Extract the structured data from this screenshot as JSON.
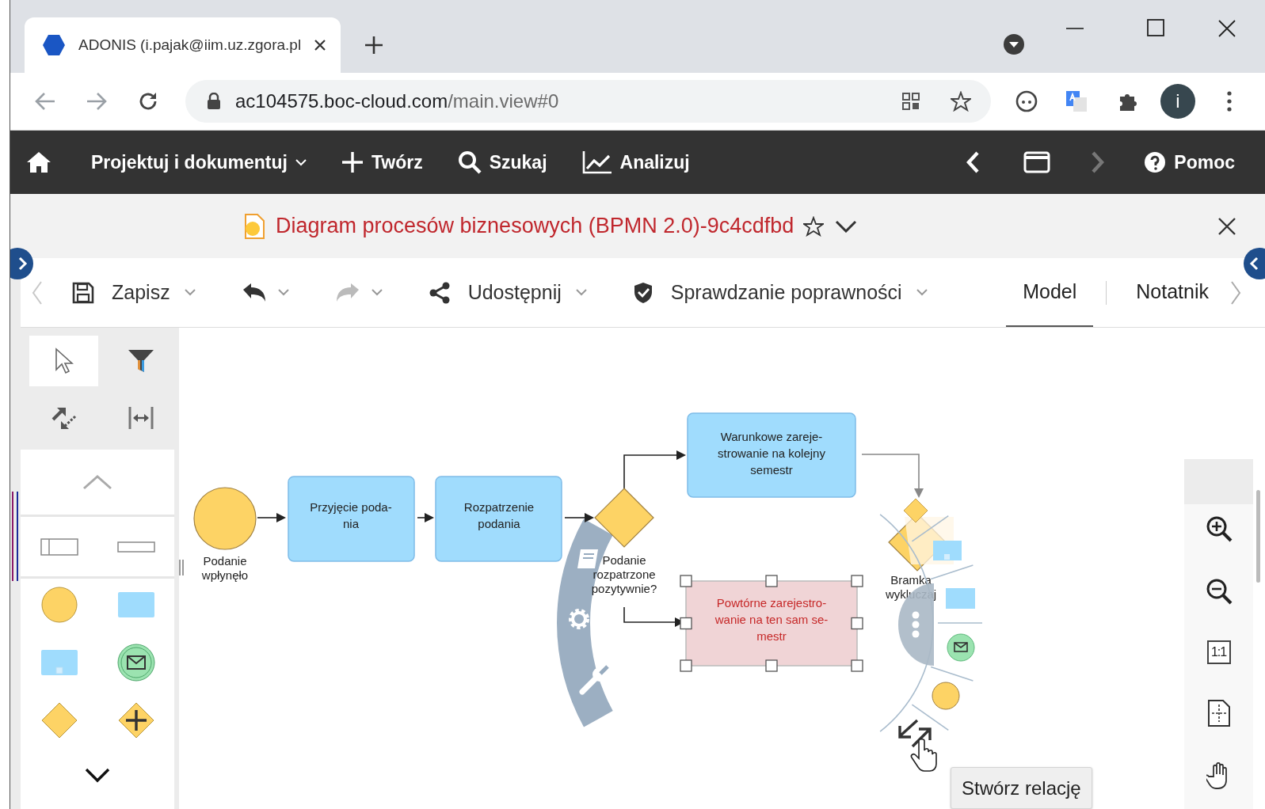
{
  "browser": {
    "tab": {
      "title": "ADONIS (i.pajak@iim.uz.zgora.pl",
      "selected": true
    },
    "url_host": "ac104575.boc-cloud.com",
    "url_path": "/main.view#0",
    "avatar_letter": "i"
  },
  "nav": {
    "items": [
      {
        "label": "Projektuj i dokumentuj",
        "kind": "menu"
      },
      {
        "label": "Twórz",
        "kind": "create"
      },
      {
        "label": "Szukaj",
        "kind": "search"
      },
      {
        "label": "Analizuj",
        "kind": "analyze"
      }
    ],
    "back_disabled": false,
    "forward_disabled": true,
    "help": "Pomoc"
  },
  "model_title": {
    "text": "Diagram procesów biznesowych (BPMN 2.0)-9c4cdfbd",
    "favorite": false
  },
  "toolbar": {
    "actions": [
      {
        "label": "Zapisz",
        "kind": "save",
        "disabled": false
      },
      {
        "kind": "undo",
        "disabled": false
      },
      {
        "kind": "redo",
        "disabled": true
      },
      {
        "label": "Udostępnij",
        "kind": "share",
        "disabled": false
      },
      {
        "label": "Sprawdzanie poprawności",
        "kind": "validate",
        "disabled": false
      }
    ],
    "tabs": [
      {
        "label": "Model",
        "selected": true
      },
      {
        "label": "Notatnik",
        "selected": false
      }
    ]
  },
  "palette": {
    "tools": [
      {
        "kind": "select",
        "selected": true
      },
      {
        "kind": "filter",
        "selected": false
      },
      {
        "kind": "connect",
        "selected": false
      },
      {
        "kind": "fit",
        "selected": false
      }
    ],
    "groups": [
      {
        "shapes": [
          {
            "kind": "pool"
          },
          {
            "kind": "lane"
          }
        ]
      },
      {
        "shapes": [
          {
            "kind": "start_event"
          },
          {
            "kind": "task"
          },
          {
            "kind": "subprocess"
          },
          {
            "kind": "message_event"
          },
          {
            "kind": "gateway"
          },
          {
            "kind": "parallel_gateway"
          }
        ]
      }
    ]
  },
  "diagram": {
    "nodes": [
      {
        "kind": "start_event",
        "label": [
          "Podanie",
          "wpłynęło"
        ],
        "selected": false
      },
      {
        "kind": "task",
        "label": [
          "Przyjęcie poda-",
          "nia"
        ],
        "selected": false
      },
      {
        "kind": "task",
        "label": [
          "Rozpatrzenie",
          "podania"
        ],
        "selected": false
      },
      {
        "kind": "gateway",
        "label": [
          "Podanie",
          "rozpatrzone",
          "pozytywnie?"
        ],
        "selected": false
      },
      {
        "kind": "task",
        "label": [
          "Warunkowe zareje-",
          "strowanie na kolejny",
          "semestr"
        ],
        "selected": false
      },
      {
        "kind": "task",
        "label": [
          "Powtórne zarejestro-",
          "wanie na ten sam se-",
          "mestr"
        ],
        "selected": true
      },
      {
        "kind": "gateway",
        "label": [
          "Bramka",
          "wykluczaj"
        ],
        "selected": false
      }
    ],
    "tooltip": "Stwórz relację"
  },
  "zoom_panel": {
    "actual_size_label": "1:1"
  }
}
